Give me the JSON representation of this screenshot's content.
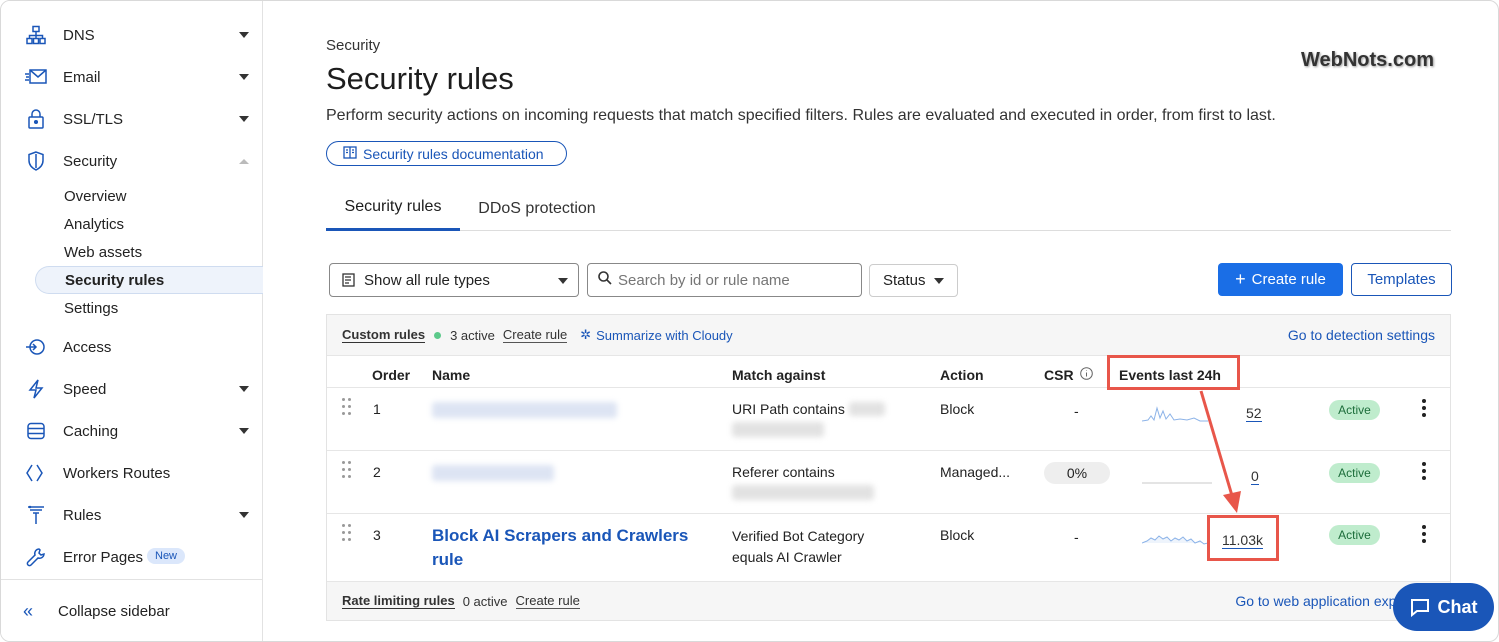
{
  "sidebar": {
    "items": [
      {
        "label": "DNS",
        "icon": "network-icon"
      },
      {
        "label": "Email",
        "icon": "email-icon"
      },
      {
        "label": "SSL/TLS",
        "icon": "lock-icon"
      },
      {
        "label": "Security",
        "icon": "shield-icon"
      },
      {
        "label": "Access",
        "icon": "access-icon"
      },
      {
        "label": "Speed",
        "icon": "lightning-icon"
      },
      {
        "label": "Caching",
        "icon": "database-icon"
      },
      {
        "label": "Workers Routes",
        "icon": "workers-icon"
      },
      {
        "label": "Rules",
        "icon": "rules-icon"
      },
      {
        "label": "Error Pages",
        "icon": "wrench-icon",
        "badge": "New"
      }
    ],
    "security_sub": [
      "Overview",
      "Analytics",
      "Web assets",
      "Security rules",
      "Settings"
    ],
    "collapse_label": "Collapse sidebar"
  },
  "header": {
    "breadcrumb": "Security",
    "title": "Security rules",
    "description": "Perform security actions on incoming requests that match specified filters. Rules are evaluated and executed in order, from first to last.",
    "doc_link": "Security rules documentation",
    "watermark": "WebNots.com"
  },
  "tabs": [
    "Security rules",
    "DDoS protection"
  ],
  "toolbar": {
    "rule_type_select": "Show all rule types",
    "search_placeholder": "Search by id or rule name",
    "status_label": "Status",
    "create_label": "Create rule",
    "templates_label": "Templates"
  },
  "custom_bar": {
    "label": "Custom rules",
    "active": "3 active",
    "create": "Create rule",
    "cloudy": "Summarize with Cloudy",
    "right_link": "Go to detection settings"
  },
  "columns": [
    "Order",
    "Name",
    "Match against",
    "Action",
    "CSR",
    "Events last 24h"
  ],
  "rows": [
    {
      "order": "1",
      "match": "URI Path contains",
      "action": "Block",
      "csr": "-",
      "events": "52",
      "status": "Active"
    },
    {
      "order": "2",
      "match": "Referer contains",
      "action": "Managed...",
      "csr": "0%",
      "events": "0",
      "status": "Active"
    },
    {
      "order": "3",
      "name_line1": "Block AI Scrapers and Crawlers",
      "name_line2": "rule",
      "match_line1": "Verified Bot Category",
      "match_line2": "equals AI Crawler",
      "action": "Block",
      "csr": "-",
      "events": "11.03k",
      "status": "Active"
    }
  ],
  "rate_bar": {
    "label": "Rate limiting rules",
    "active": "0 active",
    "create": "Create rule",
    "right_link": "Go to web application exploits se"
  },
  "chat_label": "Chat",
  "colors": {
    "accent": "#1a56b8",
    "primary_button": "#1a6ee6",
    "highlight": "#e8564a",
    "active_badge": "#bfeccd"
  }
}
